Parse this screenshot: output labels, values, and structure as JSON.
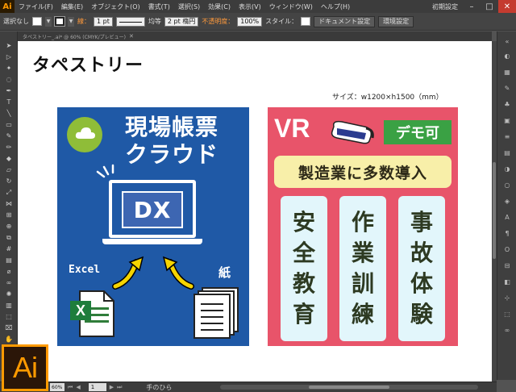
{
  "app": {
    "logo_small": "Ai",
    "logo_large": "Ai",
    "brand_color": "#ff9a00"
  },
  "menubar": {
    "items": [
      "ファイル(F)",
      "編集(E)",
      "オブジェクト(O)",
      "書式(T)",
      "選択(S)",
      "効果(C)",
      "表示(V)",
      "ウィンドウ(W)",
      "ヘルプ(H)"
    ],
    "workspace": "初期設定"
  },
  "controlbar": {
    "selection": "選択なし",
    "stroke_label": "線：",
    "stroke_value": "1 pt",
    "stroke_style": "均等",
    "brush": "2 pt 楕円",
    "opacity_label": "不透明度：",
    "opacity_value": "100%",
    "style_label": "スタイル：",
    "doc_settings": "ドキュメント設定",
    "preferences": "環境設定"
  },
  "doctab": {
    "label": "タペストリー_.ai* @ 60% (CMYK/プレビュー)"
  },
  "canvas": {
    "title": "タペストリー",
    "size_label": "サイズ：w1200×h1500（mm）"
  },
  "tapestry_left": {
    "title_line1": "現場帳票",
    "title_line2": "クラウド",
    "screen_text": "DX",
    "excel_label": "Excel",
    "paper_label": "紙",
    "excel_icon_letter": "X",
    "bg_color": "#1f59a6",
    "accent_color": "#8fbd38"
  },
  "tapestry_right": {
    "vr_text": "VR",
    "demo_badge": "デモ可",
    "banner": "製造業に多数導入",
    "pills": [
      {
        "chars": [
          "安",
          "全",
          "教",
          "育"
        ]
      },
      {
        "chars": [
          "作",
          "業",
          "訓",
          "練"
        ]
      },
      {
        "chars": [
          "事",
          "故",
          "体",
          "験"
        ]
      }
    ],
    "bg_color": "#e8546a"
  },
  "statusbar": {
    "zoom": "60%",
    "page": "1",
    "tool_name": "手のひら"
  }
}
